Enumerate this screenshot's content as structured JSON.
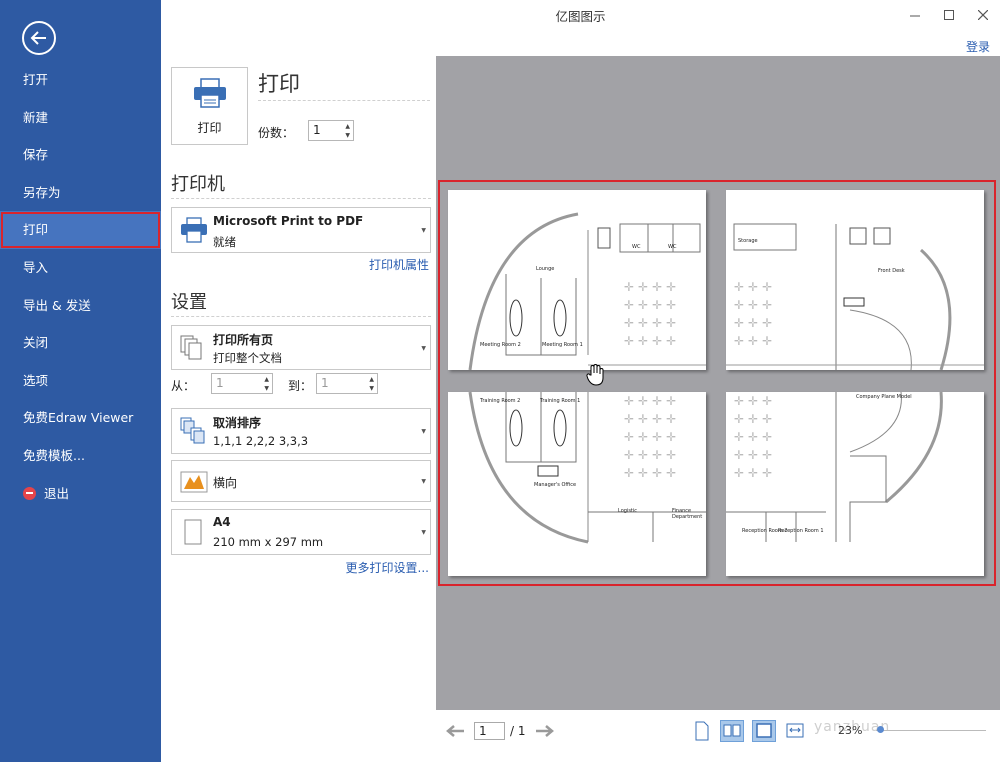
{
  "window": {
    "title": "亿图图示",
    "login_label": "登录"
  },
  "sidebar": {
    "items": [
      {
        "label": "打开"
      },
      {
        "label": "新建"
      },
      {
        "label": "保存"
      },
      {
        "label": "另存为"
      },
      {
        "label": "打印",
        "active": true
      },
      {
        "label": "导入"
      },
      {
        "label": "导出 & 发送"
      },
      {
        "label": "关闭"
      },
      {
        "label": "选项"
      },
      {
        "label": "免费Edraw Viewer"
      },
      {
        "label": "免费模板..."
      },
      {
        "label": "退出",
        "icon": "exit-icon"
      }
    ]
  },
  "print": {
    "heading": "打印",
    "button_label": "打印",
    "copies_label": "份数：",
    "copies_value": "1"
  },
  "printer": {
    "heading": "打印机",
    "name": "Microsoft Print to PDF",
    "status": "就绪",
    "properties_link": "打印机属性"
  },
  "settings": {
    "heading": "设置",
    "range_title": "打印所有页",
    "range_sub": "打印整个文档",
    "from_label": "从：",
    "from_value": "1",
    "to_label": "到：",
    "to_value": "1",
    "collate_title": "取消排序",
    "collate_sub": "1,1,1   2,2,2   3,3,3",
    "orientation": "横向",
    "paper_title": "A4",
    "paper_sub": "210 mm x 297 mm",
    "more_link": "更多打印设置..."
  },
  "preview": {
    "page_current": "1",
    "page_total": "/ 1",
    "zoom": "23%",
    "watermark": "yanzhuan",
    "room_labels": {
      "lounge": "Lounge",
      "meeting2": "Meeting Room 2",
      "meeting1": "Meeting Room 1",
      "wc": "WC",
      "training2": "Training Room 2",
      "training1": "Training Room 1",
      "manager": "Manager's Office",
      "logistics": "Logistic",
      "finance": "Finance Department",
      "storage": "Storage",
      "front_desk": "Front Desk",
      "company_plane": "Company Plane Model",
      "reception2": "Reception Room 2",
      "reception1": "Reception Room 1"
    }
  },
  "colors": {
    "sidebar_bg": "#2e5aa3",
    "active_item": "#4674bf",
    "highlight_border": "#d9242c",
    "link": "#2a5db0",
    "preview_bg": "#a2a2a6"
  }
}
